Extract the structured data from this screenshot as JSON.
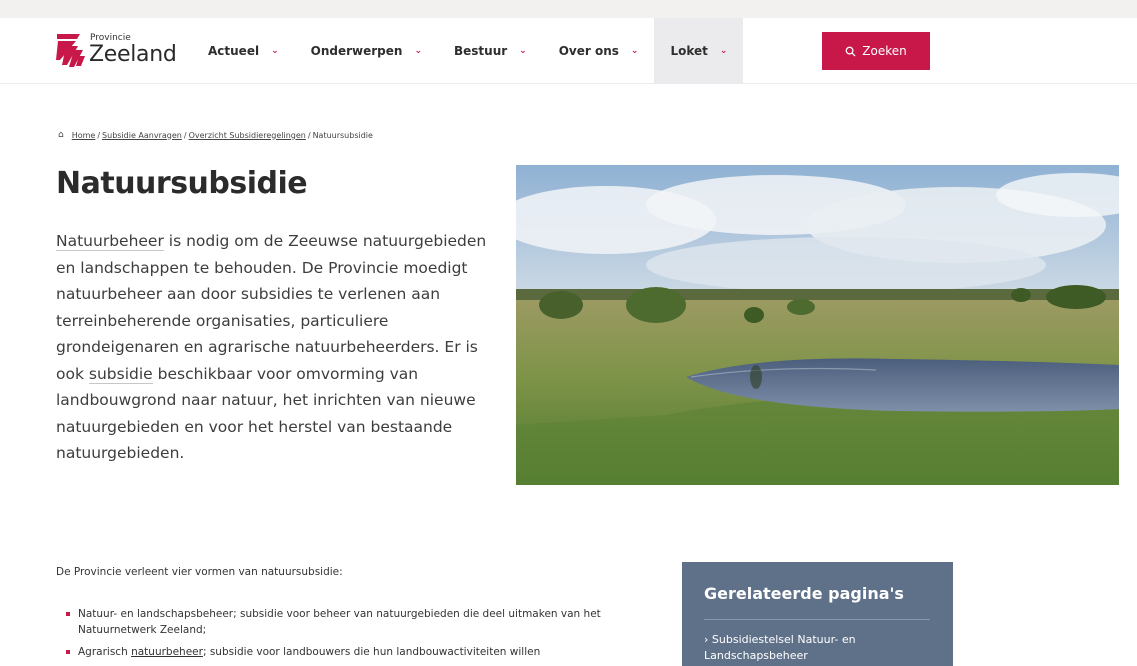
{
  "brand": {
    "small": "Provincie",
    "name": "Zeeland"
  },
  "nav": [
    {
      "label": "Actueel"
    },
    {
      "label": "Onderwerpen"
    },
    {
      "label": "Bestuur"
    },
    {
      "label": "Over ons"
    },
    {
      "label": "Loket"
    }
  ],
  "search": {
    "label": "Zoeken"
  },
  "breadcrumb": [
    {
      "label": "Home"
    },
    {
      "label": "Subsidie Aanvragen"
    },
    {
      "label": "Overzicht Subsidieregelingen"
    },
    {
      "label": "Natuursubsidie"
    }
  ],
  "page": {
    "title": "Natuursubsidie",
    "intro": {
      "link1": "Natuurbeheer",
      "part1": " is nodig om de Zeeuwse natuurgebieden en landschappen te behouden. De Provincie moedigt natuurbeheer aan door subsidies te verlenen aan terreinbeherende organisaties, particuliere grondeigenaren en agrarische natuurbeheerders. Er is ook ",
      "link2": "subsidie",
      "part2": " beschikbaar voor omvorming van landbouwgrond naar natuur, het inrichten van nieuwe natuurgebieden en voor het herstel van bestaande natuurgebieden."
    },
    "body_intro": "De Provincie verleent vier vormen van natuursubsidie:",
    "bullets": [
      {
        "text": "Natuur- en landschapsbeheer; subsidie voor beheer van natuurgebieden die deel uitmaken van het Natuurnetwerk Zeeland;"
      },
      {
        "pre": "Agrarisch ",
        "link": "natuurbeheer",
        "post": "; subsidie voor landbouwers die hun landbouwactiviteiten willen"
      }
    ]
  },
  "related": {
    "title": "Gerelateerde pagina's",
    "link": "Subsidiestelsel Natuur- en Landschapsbeheer"
  },
  "colors": {
    "accent": "#c8184a",
    "panel": "#5f7189",
    "nav_active": "#ebebed"
  }
}
